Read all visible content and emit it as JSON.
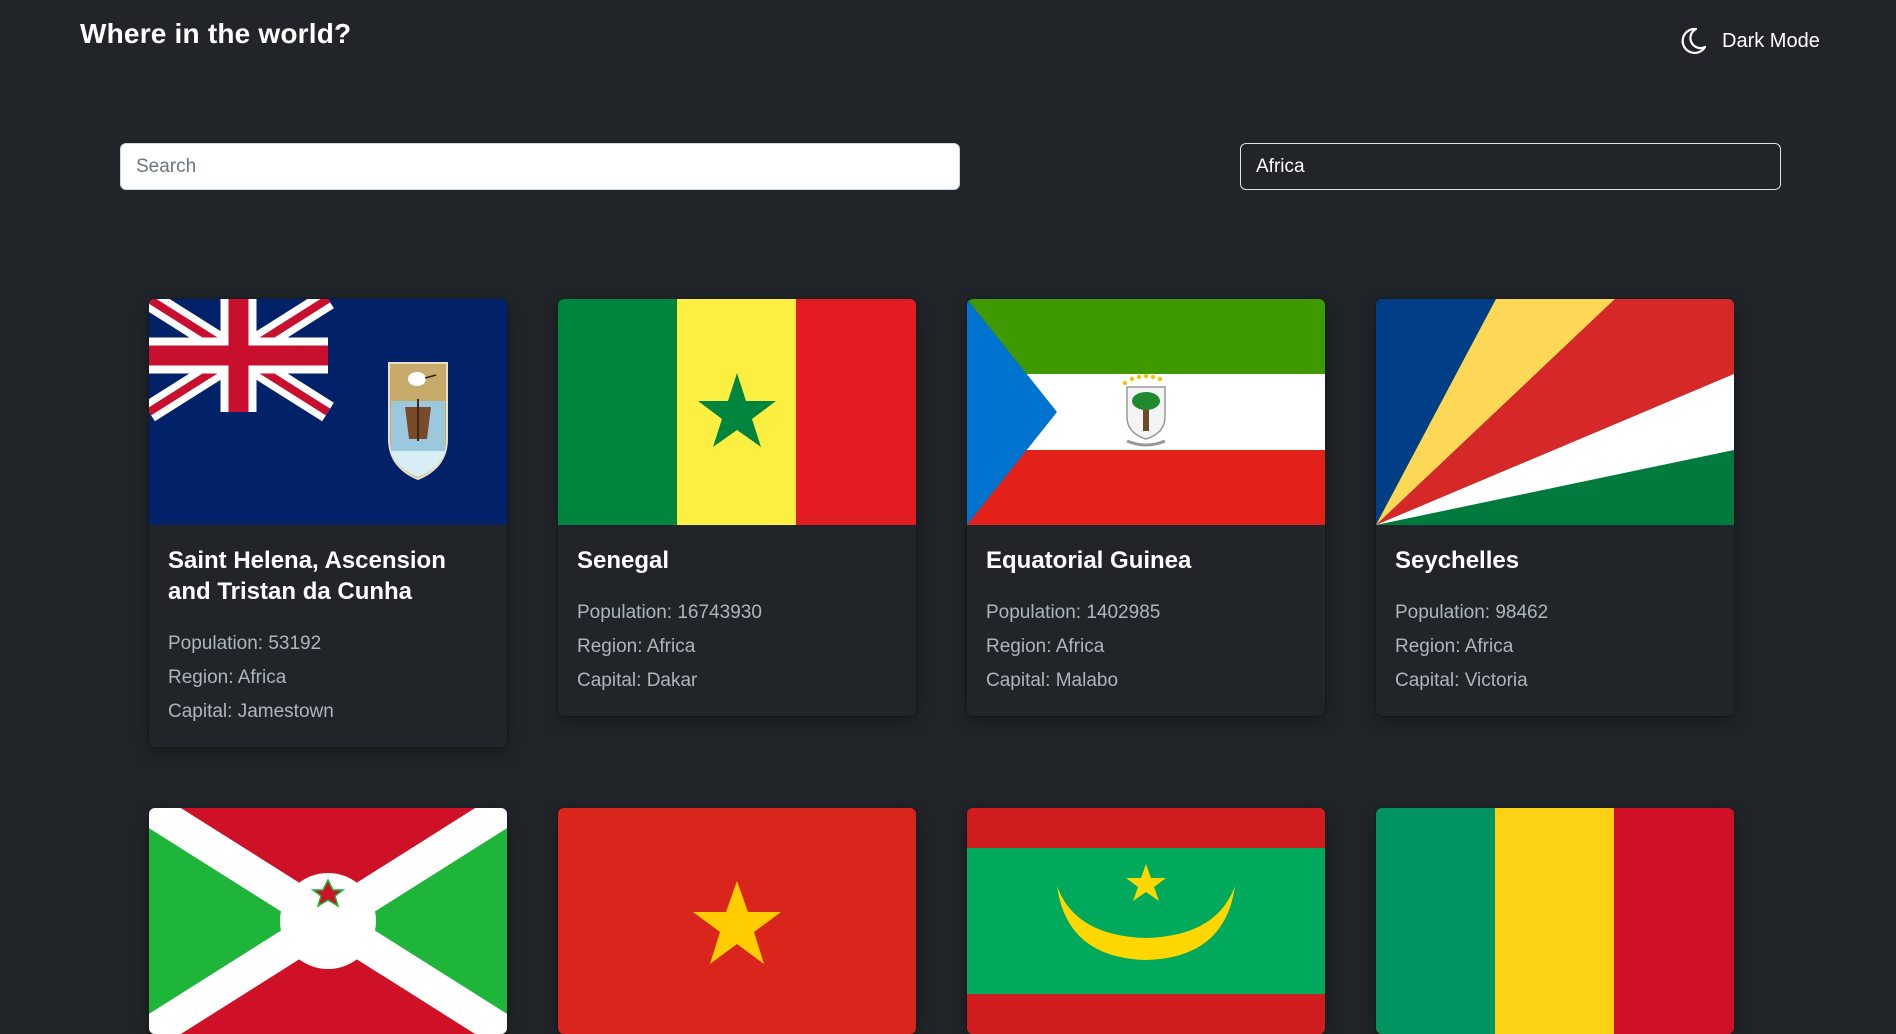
{
  "header": {
    "title": "Where in the world?",
    "theme_toggle": {
      "label": "Dark Mode",
      "icon": "moon-icon"
    }
  },
  "filters": {
    "search_placeholder": "Search",
    "search_value": "",
    "region_selected": "Africa"
  },
  "countries": [
    {
      "name": "Saint Helena, Ascension and Tristan da Cunha",
      "population": "53192",
      "region": "Africa",
      "capital": "Jamestown",
      "flag": "saint-helena-flag"
    },
    {
      "name": "Senegal",
      "population": "16743930",
      "region": "Africa",
      "capital": "Dakar",
      "flag": "senegal-flag"
    },
    {
      "name": "Equatorial Guinea",
      "population": "1402985",
      "region": "Africa",
      "capital": "Malabo",
      "flag": "equatorial-guinea-flag"
    },
    {
      "name": "Seychelles",
      "population": "98462",
      "region": "Africa",
      "capital": "Victoria",
      "flag": "seychelles-flag"
    },
    {
      "flag": "burundi-flag"
    },
    {
      "flag": "vietnam-flag"
    },
    {
      "flag": "mauritania-flag"
    },
    {
      "flag": "guinea-flag"
    }
  ],
  "labels": {
    "population": "Population: ",
    "region": "Region: ",
    "capital": "Capital: "
  }
}
